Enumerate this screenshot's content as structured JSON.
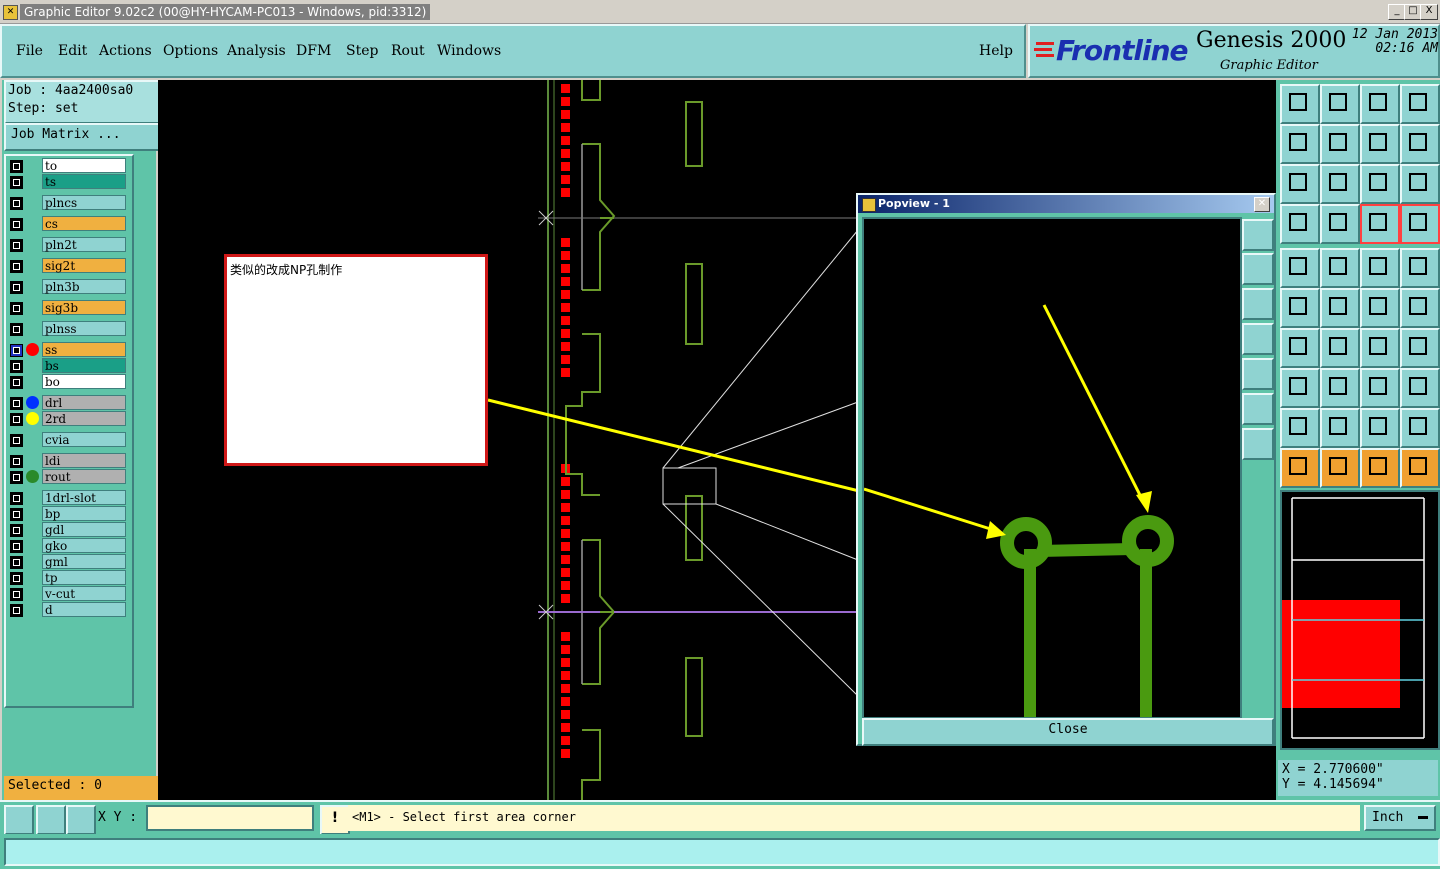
{
  "window": {
    "title": "Graphic Editor 9.02c2 (00@HY-HYCAM-PC013 - Windows, pid:3312)",
    "minimize": "_",
    "maximize": "□",
    "close": "X"
  },
  "menu": {
    "items": [
      "File",
      "Edit",
      "Actions",
      "Options",
      "Analysis",
      "DFM",
      "Step",
      "Rout",
      "Windows"
    ],
    "help": "Help"
  },
  "brand": {
    "logo": "Frontline",
    "product": "Genesis 2000",
    "subtitle": "Graphic Editor",
    "date": "12 Jan 2013",
    "time": "02:16 AM"
  },
  "job": {
    "job_label": "Job : 4aa2400sa0",
    "step_label": "Step: set",
    "matrix_button": "Job Matrix ..."
  },
  "layers": [
    {
      "name": "to",
      "color": "#ffffff"
    },
    {
      "name": "ts",
      "color": "#1a9f87"
    },
    {
      "name": "plncs",
      "color": "#8fd3d1"
    },
    {
      "name": "cs",
      "color": "#f0b040"
    },
    {
      "name": "pln2t",
      "color": "#8fd3d1"
    },
    {
      "name": "sig2t",
      "color": "#f0b040"
    },
    {
      "name": "pln3b",
      "color": "#8fd3d1"
    },
    {
      "name": "sig3b",
      "color": "#f0b040"
    },
    {
      "name": "plnss",
      "color": "#8fd3d1"
    },
    {
      "name": "ss",
      "color": "#f0b040",
      "dot": "#ff0000",
      "active": true
    },
    {
      "name": "bs",
      "color": "#1a9f87"
    },
    {
      "name": "bo",
      "color": "#ffffff"
    },
    {
      "name": "drl",
      "color": "#b0b0b0",
      "dot": "#0030ff"
    },
    {
      "name": "2rd",
      "color": "#b0b0b0",
      "dot": "#ffff00"
    },
    {
      "name": "cvia",
      "color": "#8fd3d1"
    },
    {
      "name": "ldi",
      "color": "#b0b0b0"
    },
    {
      "name": "rout",
      "color": "#b0b0b0",
      "dot": "#2a8a2a"
    },
    {
      "name": "1drl-slot",
      "color": "#8fd3d1"
    },
    {
      "name": "bp",
      "color": "#8fd3d1"
    },
    {
      "name": "gdl",
      "color": "#8fd3d1"
    },
    {
      "name": "gko",
      "color": "#8fd3d1"
    },
    {
      "name": "gml",
      "color": "#8fd3d1"
    },
    {
      "name": "tp",
      "color": "#8fd3d1"
    },
    {
      "name": "v-cut",
      "color": "#8fd3d1"
    },
    {
      "name": "d",
      "color": "#8fd3d1"
    }
  ],
  "selected": "Selected : 0",
  "annotation": {
    "text": "类似的改成NP孔制作"
  },
  "popview": {
    "title": "Popview - 1",
    "close_button": "Close"
  },
  "coords": {
    "x": "X = 2.770600\"",
    "y": "Y = 4.145694\""
  },
  "bottom": {
    "xy_label": "X Y :",
    "xy_value": "",
    "warn": "!",
    "prompt": "<M1> - Select first area corner",
    "units": "Inch"
  },
  "status": {
    "text": ""
  },
  "colors": {
    "panel": "#5fc4a8",
    "button": "#8fd3d1",
    "canvas": "#000000",
    "pad_green": "#4a9a10",
    "arrow_yellow": "#ffff00"
  }
}
